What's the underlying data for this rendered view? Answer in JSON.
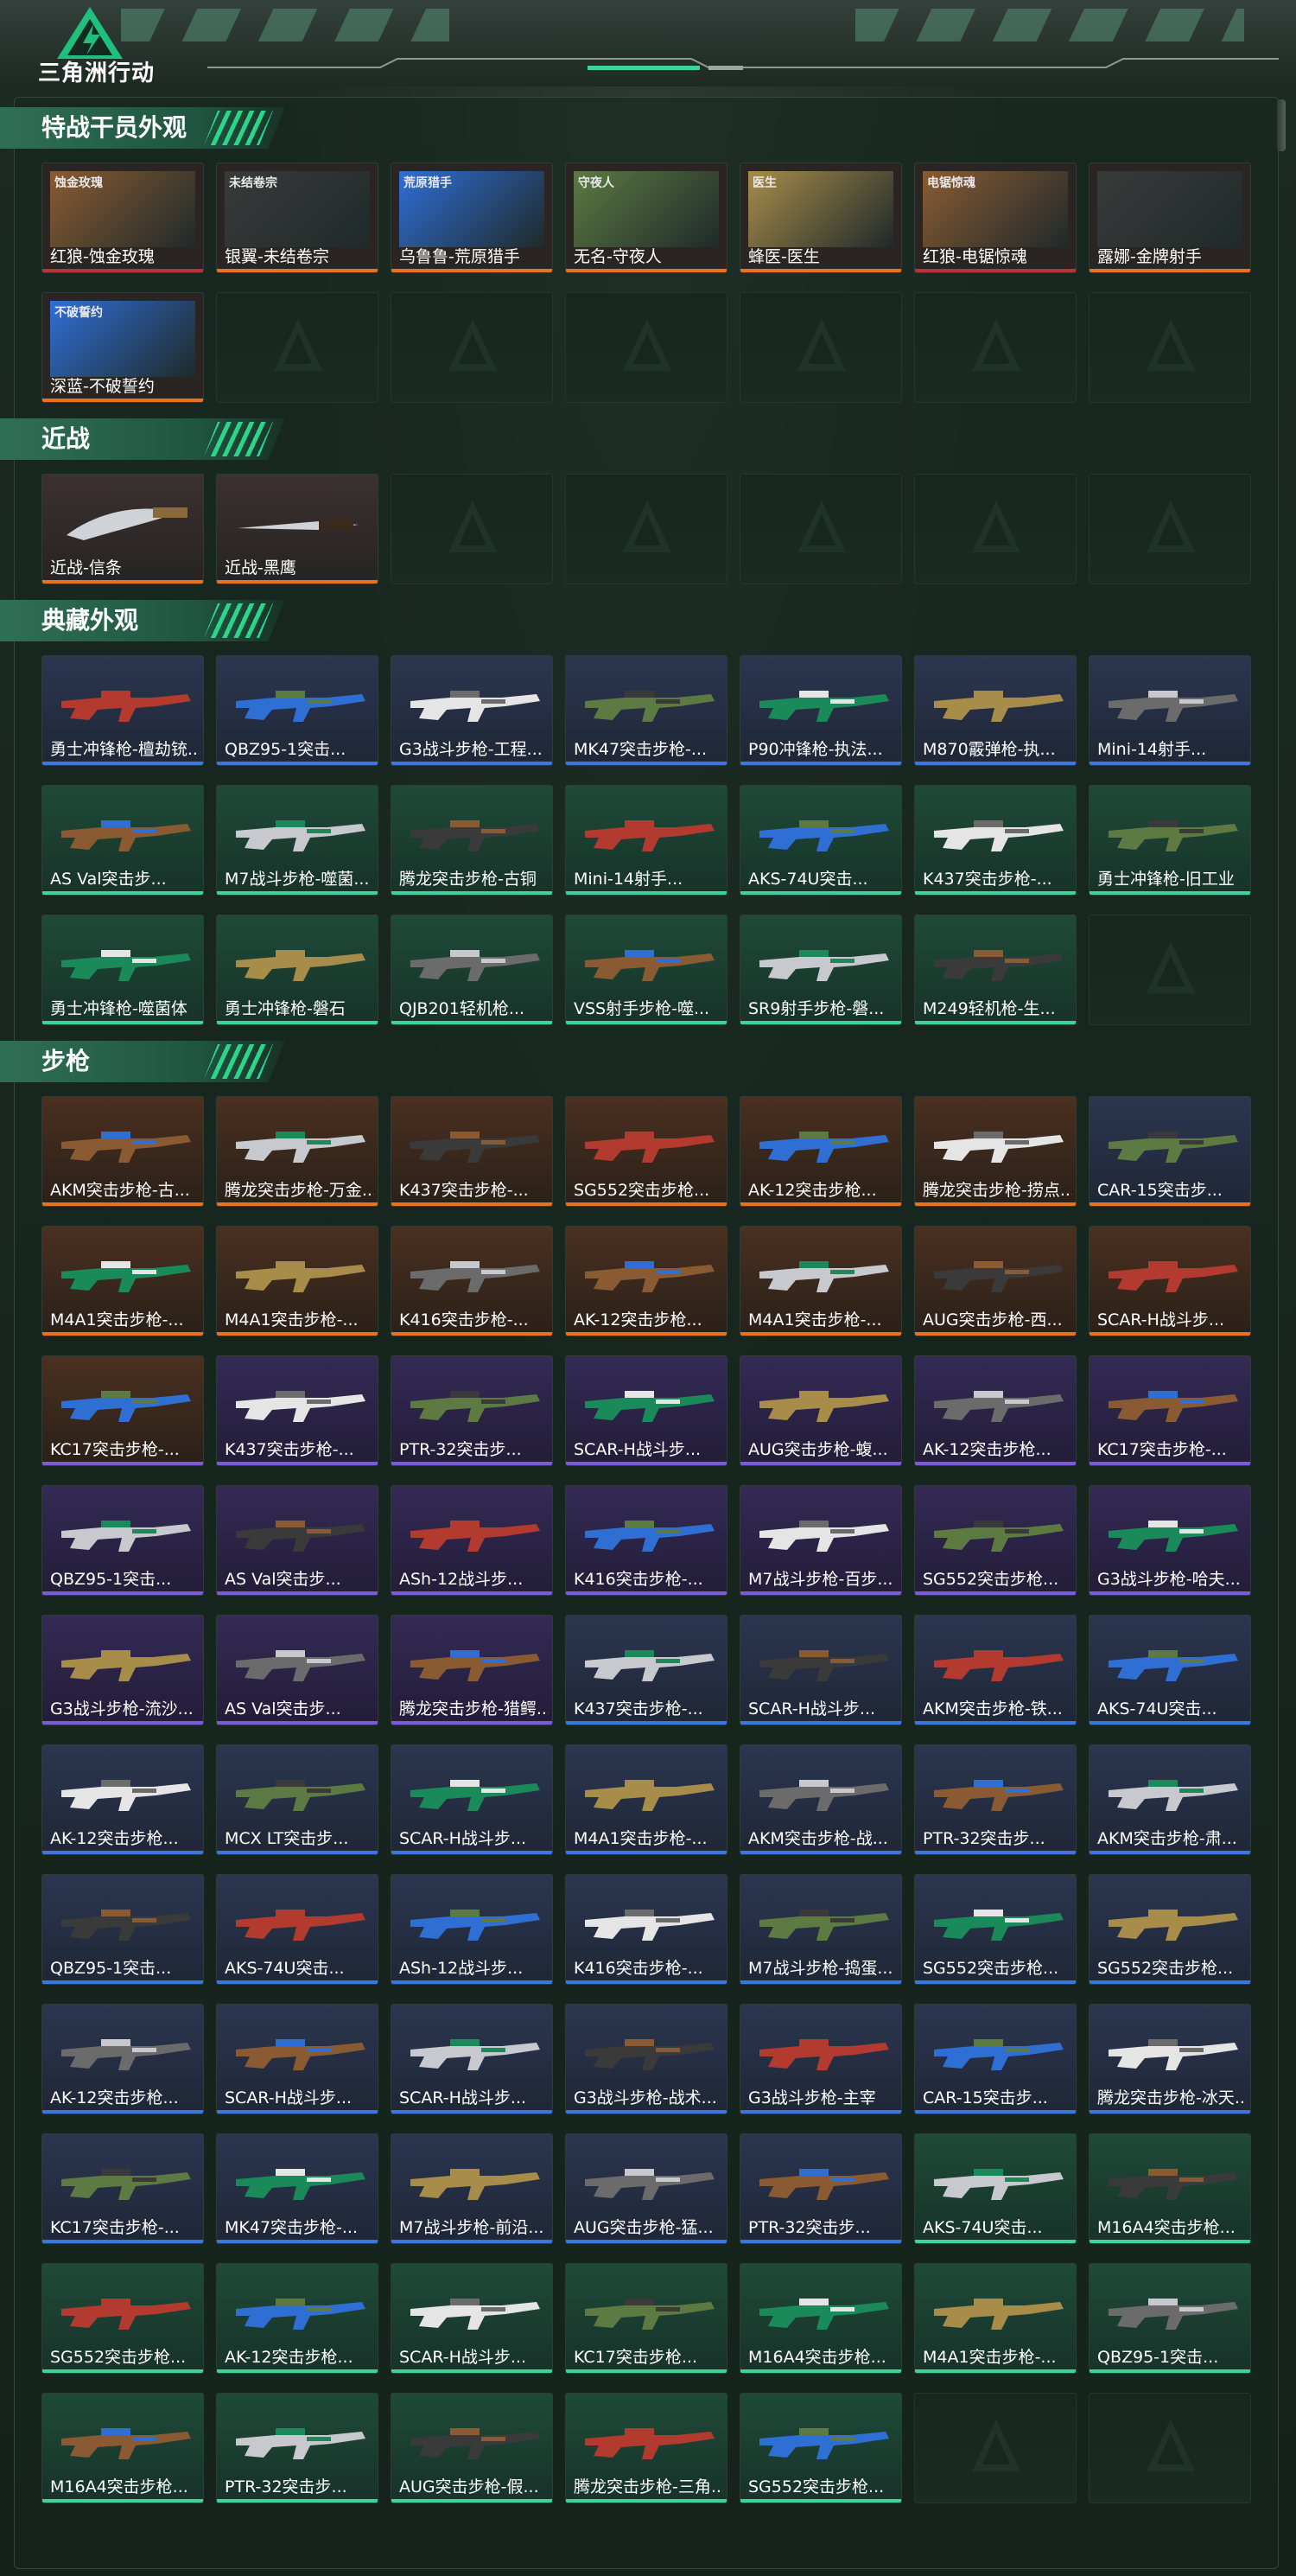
{
  "header": {
    "logo_text": "三角洲行动"
  },
  "colors": {
    "orange_bar": "#e8731c",
    "blue_bar": "#3b77e0",
    "green_bar": "#3dd49a",
    "purple_bar": "#7c5ad8",
    "red_bar": "#b8323a",
    "accent_green": "#2bd68b"
  },
  "sections": [
    {
      "title": "特战干员外观",
      "kind": "agent",
      "items": [
        {
          "label": "红狼-蚀金玫瑰",
          "brand": "蚀金玫瑰",
          "bar": "red"
        },
        {
          "label": "银翼-未结卷宗",
          "brand": "未结卷宗",
          "bar": "orange"
        },
        {
          "label": "乌鲁鲁-荒原猎手",
          "brand": "荒原猎手",
          "bar": "orange"
        },
        {
          "label": "无名-守夜人",
          "brand": "守夜人",
          "bar": "orange"
        },
        {
          "label": "蜂医-医生",
          "brand": "医生",
          "bar": "orange"
        },
        {
          "label": "红狼-电锯惊魂",
          "brand": "电锯惊魂",
          "bar": "red"
        },
        {
          "label": "露娜-金牌射手",
          "brand": "",
          "bar": "orange"
        },
        {
          "label": "深蓝-不破誓约",
          "brand": "不破誓约",
          "bar": "orange"
        }
      ],
      "empty": 6
    },
    {
      "title": "近战",
      "kind": "knife",
      "items": [
        {
          "label": "近战-信条",
          "bar": "orange"
        },
        {
          "label": "近战-黑鹰",
          "bar": "orange"
        }
      ],
      "empty": 5
    },
    {
      "title": "典藏外观",
      "kind": "gun",
      "items": [
        {
          "label": "勇士冲锋枪-檀劫铳...",
          "tone": "blue",
          "bar": "blue"
        },
        {
          "label": "QBZ95-1突击...",
          "tone": "blue",
          "bar": "blue"
        },
        {
          "label": "G3战斗步枪-工程...",
          "tone": "blue",
          "bar": "blue"
        },
        {
          "label": "MK47突击步枪-...",
          "tone": "blue",
          "bar": "blue"
        },
        {
          "label": "P90冲锋枪-执法...",
          "tone": "blue",
          "bar": "blue"
        },
        {
          "label": "M870霰弹枪-执...",
          "tone": "blue",
          "bar": "blue"
        },
        {
          "label": "Mini-14射手...",
          "tone": "blue",
          "bar": "blue"
        },
        {
          "label": "AS Val突击步...",
          "tone": "green",
          "bar": "green"
        },
        {
          "label": "M7战斗步枪-噬菌...",
          "tone": "green",
          "bar": "green"
        },
        {
          "label": "腾龙突击步枪-古铜",
          "tone": "green",
          "bar": "green"
        },
        {
          "label": "Mini-14射手...",
          "tone": "green",
          "bar": "green"
        },
        {
          "label": "AKS-74U突击...",
          "tone": "green",
          "bar": "green"
        },
        {
          "label": "K437突击步枪-...",
          "tone": "green",
          "bar": "green"
        },
        {
          "label": "勇士冲锋枪-旧工业",
          "tone": "green",
          "bar": "green"
        },
        {
          "label": "勇士冲锋枪-噬菌体",
          "tone": "green",
          "bar": "green"
        },
        {
          "label": "勇士冲锋枪-磐石",
          "tone": "green",
          "bar": "green"
        },
        {
          "label": "QJB201轻机枪...",
          "tone": "green",
          "bar": "green"
        },
        {
          "label": "VSS射手步枪-噬...",
          "tone": "green",
          "bar": "green"
        },
        {
          "label": "SR9射手步枪-磐...",
          "tone": "green",
          "bar": "green"
        },
        {
          "label": "M249轻机枪-生...",
          "tone": "green",
          "bar": "green"
        }
      ],
      "empty": 1
    },
    {
      "title": "步枪",
      "kind": "gun",
      "items": [
        {
          "label": "AKM突击步枪-古...",
          "tone": "orange",
          "bar": "orange"
        },
        {
          "label": "腾龙突击步枪-万金...",
          "tone": "orange",
          "bar": "orange"
        },
        {
          "label": "K437突击步枪-...",
          "tone": "orange",
          "bar": "orange"
        },
        {
          "label": "SG552突击步枪...",
          "tone": "orange",
          "bar": "orange"
        },
        {
          "label": "AK-12突击步枪...",
          "tone": "orange",
          "bar": "orange"
        },
        {
          "label": "腾龙突击步枪-捞点...",
          "tone": "orange",
          "bar": "orange"
        },
        {
          "label": "CAR-15突击步...",
          "tone": "blue",
          "bar": "orange"
        },
        {
          "label": "M4A1突击步枪-...",
          "tone": "orange",
          "bar": "orange"
        },
        {
          "label": "M4A1突击步枪-...",
          "tone": "orange",
          "bar": "orange"
        },
        {
          "label": "K416突击步枪-...",
          "tone": "orange",
          "bar": "orange"
        },
        {
          "label": "AK-12突击步枪...",
          "tone": "orange",
          "bar": "orange"
        },
        {
          "label": "M4A1突击步枪-...",
          "tone": "orange",
          "bar": "orange"
        },
        {
          "label": "AUG突击步枪-西...",
          "tone": "orange",
          "bar": "orange"
        },
        {
          "label": "SCAR-H战斗步...",
          "tone": "orange",
          "bar": "orange"
        },
        {
          "label": "KC17突击步枪-...",
          "tone": "orange",
          "bar": "purple"
        },
        {
          "label": "K437突击步枪-...",
          "tone": "purple",
          "bar": "purple"
        },
        {
          "label": "PTR-32突击步...",
          "tone": "purple",
          "bar": "purple"
        },
        {
          "label": "SCAR-H战斗步...",
          "tone": "purple",
          "bar": "purple"
        },
        {
          "label": "AUG突击步枪-蝮...",
          "tone": "purple",
          "bar": "purple"
        },
        {
          "label": "AK-12突击步枪...",
          "tone": "purple",
          "bar": "purple"
        },
        {
          "label": "KC17突击步枪-...",
          "tone": "purple",
          "bar": "purple"
        },
        {
          "label": "QBZ95-1突击...",
          "tone": "purple",
          "bar": "purple"
        },
        {
          "label": "AS Val突击步...",
          "tone": "purple",
          "bar": "purple"
        },
        {
          "label": "ASh-12战斗步...",
          "tone": "purple",
          "bar": "purple"
        },
        {
          "label": "K416突击步枪-...",
          "tone": "purple",
          "bar": "purple"
        },
        {
          "label": "M7战斗步枪-百步...",
          "tone": "purple",
          "bar": "purple"
        },
        {
          "label": "SG552突击步枪...",
          "tone": "purple",
          "bar": "purple"
        },
        {
          "label": "G3战斗步枪-哈夫...",
          "tone": "purple",
          "bar": "purple"
        },
        {
          "label": "G3战斗步枪-流沙...",
          "tone": "purple",
          "bar": "purple"
        },
        {
          "label": "AS Val突击步...",
          "tone": "purple",
          "bar": "purple"
        },
        {
          "label": "腾龙突击步枪-猎鳄...",
          "tone": "purple",
          "bar": "purple"
        },
        {
          "label": "K437突击步枪-...",
          "tone": "blue",
          "bar": "blue"
        },
        {
          "label": "SCAR-H战斗步...",
          "tone": "blue",
          "bar": "blue"
        },
        {
          "label": "AKM突击步枪-铁...",
          "tone": "blue",
          "bar": "blue"
        },
        {
          "label": "AKS-74U突击...",
          "tone": "blue",
          "bar": "blue"
        },
        {
          "label": "AK-12突击步枪...",
          "tone": "blue",
          "bar": "blue"
        },
        {
          "label": "MCX LT突击步...",
          "tone": "blue",
          "bar": "blue"
        },
        {
          "label": "SCAR-H战斗步...",
          "tone": "blue",
          "bar": "blue"
        },
        {
          "label": "M4A1突击步枪-...",
          "tone": "blue",
          "bar": "blue"
        },
        {
          "label": "AKM突击步枪-战...",
          "tone": "blue",
          "bar": "blue"
        },
        {
          "label": "PTR-32突击步...",
          "tone": "blue",
          "bar": "blue"
        },
        {
          "label": "AKM突击步枪-肃...",
          "tone": "blue",
          "bar": "blue"
        },
        {
          "label": "QBZ95-1突击...",
          "tone": "blue",
          "bar": "blue"
        },
        {
          "label": "AKS-74U突击...",
          "tone": "blue",
          "bar": "blue"
        },
        {
          "label": "ASh-12战斗步...",
          "tone": "blue",
          "bar": "blue"
        },
        {
          "label": "K416突击步枪-...",
          "tone": "blue",
          "bar": "blue"
        },
        {
          "label": "M7战斗步枪-捣蛋...",
          "tone": "blue",
          "bar": "blue"
        },
        {
          "label": "SG552突击步枪...",
          "tone": "blue",
          "bar": "blue"
        },
        {
          "label": "SG552突击步枪...",
          "tone": "blue",
          "bar": "blue"
        },
        {
          "label": "AK-12突击步枪...",
          "tone": "blue",
          "bar": "blue"
        },
        {
          "label": "SCAR-H战斗步...",
          "tone": "blue",
          "bar": "blue"
        },
        {
          "label": "SCAR-H战斗步...",
          "tone": "blue",
          "bar": "blue"
        },
        {
          "label": "G3战斗步枪-战术...",
          "tone": "blue",
          "bar": "blue"
        },
        {
          "label": "G3战斗步枪-主宰",
          "tone": "blue",
          "bar": "blue"
        },
        {
          "label": "CAR-15突击步...",
          "tone": "blue",
          "bar": "blue"
        },
        {
          "label": "腾龙突击步枪-冰天...",
          "tone": "blue",
          "bar": "blue"
        },
        {
          "label": "KC17突击步枪-...",
          "tone": "blue",
          "bar": "blue"
        },
        {
          "label": "MK47突击步枪-...",
          "tone": "blue",
          "bar": "blue"
        },
        {
          "label": "M7战斗步枪-前沿...",
          "tone": "blue",
          "bar": "blue"
        },
        {
          "label": "AUG突击步枪-猛...",
          "tone": "blue",
          "bar": "blue"
        },
        {
          "label": "PTR-32突击步...",
          "tone": "blue",
          "bar": "blue"
        },
        {
          "label": "AKS-74U突击...",
          "tone": "green",
          "bar": "green"
        },
        {
          "label": "M16A4突击步枪...",
          "tone": "green",
          "bar": "green"
        },
        {
          "label": "SG552突击步枪...",
          "tone": "green",
          "bar": "green"
        },
        {
          "label": "AK-12突击步枪...",
          "tone": "green",
          "bar": "green"
        },
        {
          "label": "SCAR-H战斗步...",
          "tone": "green",
          "bar": "green"
        },
        {
          "label": "KC17突击步枪...",
          "tone": "green",
          "bar": "green"
        },
        {
          "label": "M16A4突击步枪...",
          "tone": "green",
          "bar": "green"
        },
        {
          "label": "M4A1突击步枪-...",
          "tone": "green",
          "bar": "green"
        },
        {
          "label": "QBZ95-1突击...",
          "tone": "green",
          "bar": "green"
        },
        {
          "label": "M16A4突击步枪...",
          "tone": "green",
          "bar": "green"
        },
        {
          "label": "PTR-32突击步...",
          "tone": "green",
          "bar": "green"
        },
        {
          "label": "AUG突击步枪-假...",
          "tone": "green",
          "bar": "green"
        },
        {
          "label": "腾龙突击步枪-三角...",
          "tone": "green",
          "bar": "green"
        },
        {
          "label": "SG552突击步枪...",
          "tone": "green",
          "bar": "green"
        }
      ],
      "empty": 2
    }
  ]
}
